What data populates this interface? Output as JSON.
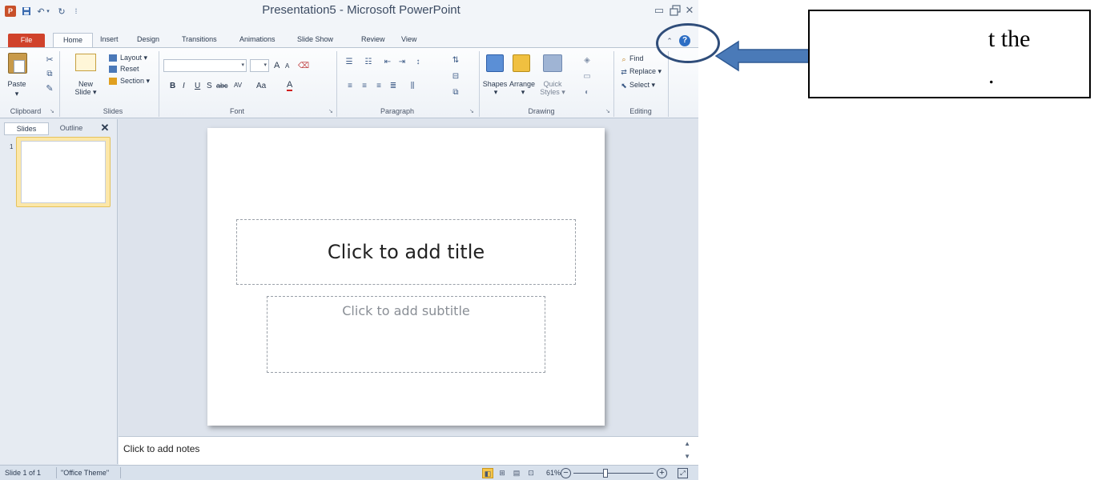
{
  "window": {
    "title": "Presentation5 - Microsoft PowerPoint",
    "app_logo": "P"
  },
  "qat": {
    "save_icon": "save-icon",
    "undo_icon": "undo-icon",
    "redo_icon": "redo-icon"
  },
  "tabs": {
    "file": "File",
    "home": "Home",
    "insert": "Insert",
    "design": "Design",
    "transitions": "Transitions",
    "animations": "Animations",
    "slideshow": "Slide Show",
    "review": "Review",
    "view": "View"
  },
  "ribbon": {
    "clipboard": {
      "label": "Clipboard",
      "paste": "Paste"
    },
    "slides": {
      "label": "Slides",
      "new_slide_line1": "New",
      "new_slide_line2": "Slide ▾",
      "layout": "Layout ▾",
      "reset": "Reset",
      "section": "Section ▾"
    },
    "font": {
      "label": "Font",
      "bold": "B",
      "italic": "I",
      "underline": "U",
      "shadow": "S",
      "strike": "abc",
      "spacing": "AV",
      "case": "Aa",
      "color": "A",
      "grow": "A",
      "shrink": "A"
    },
    "paragraph": {
      "label": "Paragraph"
    },
    "drawing": {
      "label": "Drawing",
      "shapes": "Shapes",
      "arrange": "Arrange",
      "quick_styles_line1": "Quick",
      "quick_styles_line2": "Styles ▾"
    },
    "editing": {
      "label": "Editing",
      "find": "Find",
      "replace": "Replace ▾",
      "select": "Select ▾"
    }
  },
  "left_pane": {
    "tab_slides": "Slides",
    "tab_outline": "Outline",
    "close": "✕",
    "thumb_number": "1"
  },
  "slide": {
    "title_placeholder": "Click to add title",
    "subtitle_placeholder": "Click to add subtitle"
  },
  "notes": {
    "placeholder": "Click to add notes"
  },
  "status": {
    "slide_info": "Slide 1 of 1",
    "theme": "\"Office Theme\"",
    "zoom": "61%",
    "zoom_fraction": 0.4
  },
  "callout": {
    "line1": "t the",
    "line2": ".",
    "arrow_color": "#4a7ab8",
    "circle_color": "#2f4d7a"
  },
  "colors": {
    "file_tab": "#d0422b",
    "accent": "#2d6ec4"
  }
}
